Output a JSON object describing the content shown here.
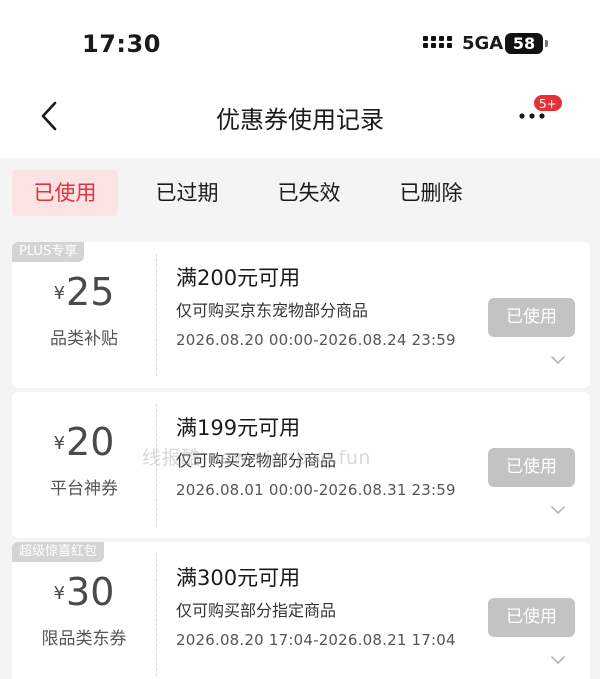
{
  "status_bar": {
    "time": "17:30",
    "network": "5GA",
    "battery": "58"
  },
  "nav": {
    "title": "优惠券使用记录",
    "badge": "5+"
  },
  "tabs": [
    {
      "label": "已使用",
      "active": true
    },
    {
      "label": "已过期",
      "active": false
    },
    {
      "label": "已失效",
      "active": false
    },
    {
      "label": "已删除",
      "active": false
    }
  ],
  "coupons": [
    {
      "tag": "PLUS专享",
      "currency": "¥",
      "amount": "25",
      "name": "品类补贴",
      "condition": "满200元可用",
      "scope": "仅可购买京东宠物部分商品",
      "period": "2026.08.20 00:00-2026.08.24 23:59",
      "status": "已使用"
    },
    {
      "tag": "",
      "currency": "¥",
      "amount": "20",
      "name": "平台神券",
      "condition": "满199元可用",
      "scope": "仅可购买宠物部分商品",
      "period": "2026.08.01 00:00-2026.08.31 23:59",
      "status": "已使用"
    },
    {
      "tag": "超级惊喜红包",
      "currency": "¥",
      "amount": "30",
      "name": "限品类东券",
      "condition": "满300元可用",
      "scope": "仅可购买部分指定商品",
      "period": "2026.08.20 17:04-2026.08.21 17:04",
      "status": "已使用"
    }
  ],
  "watermark": "线报酷-new.xianbao.fun",
  "colors": {
    "accent": "#e4313a",
    "active_tab_bg": "#fbe3e4",
    "used_button": "#c3c3c3",
    "tag_bg": "#d4d4d4"
  },
  "icons": [
    "back-arrow-icon",
    "more-dots-icon",
    "chevron-down-icon",
    "signal-icon",
    "battery-icon"
  ]
}
